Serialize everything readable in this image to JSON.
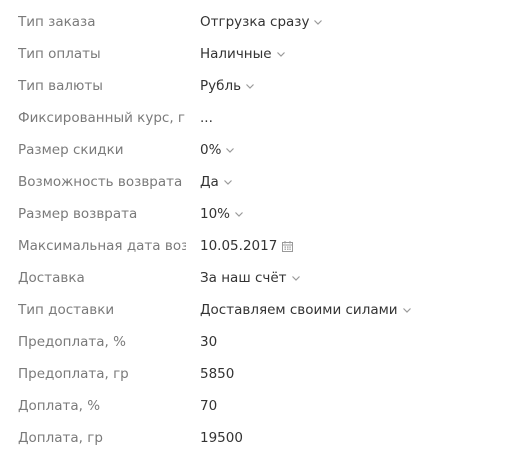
{
  "fields": {
    "order_type": {
      "label": "Тип заказа",
      "value": "Отгрузка сразу"
    },
    "payment_type": {
      "label": "Тип оплаты",
      "value": "Наличные"
    },
    "currency_type": {
      "label": "Тип валюты",
      "value": "Рубль"
    },
    "fixed_rate": {
      "label": "Фиксированный курс, гр",
      "value": "..."
    },
    "discount": {
      "label": "Размер скидки",
      "value": "0%"
    },
    "return_possible": {
      "label": "Возможность возврата",
      "value": "Да"
    },
    "return_size": {
      "label": "Размер возврата",
      "value": "10%"
    },
    "max_return_date": {
      "label": "Максимальная дата возврата",
      "value": "10.05.2017"
    },
    "delivery": {
      "label": "Доставка",
      "value": "За наш счёт"
    },
    "delivery_type": {
      "label": "Тип доставки",
      "value": "Доставляем своими силами"
    },
    "prepayment_percent": {
      "label": "Предоплата, %",
      "value": "30"
    },
    "prepayment_amount": {
      "label": "Предоплата, гр",
      "value": "5850"
    },
    "surcharge_percent": {
      "label": "Доплата, %",
      "value": "70"
    },
    "surcharge_amount": {
      "label": "Доплата, гр",
      "value": "19500"
    }
  },
  "icons": {
    "dropdown": "chevron-down-icon",
    "date": "calendar-icon"
  },
  "colors": {
    "label": "#7a7a7a",
    "value": "#333333",
    "icon": "#9a9a9a"
  }
}
